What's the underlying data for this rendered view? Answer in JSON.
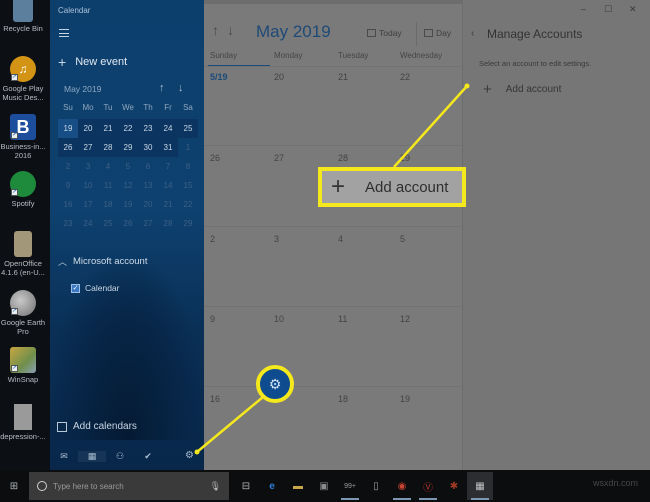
{
  "desktop": {
    "icons": [
      {
        "label": "Recycle Bin",
        "icon": "recycle-bin-icon",
        "color": "#6b8fb0"
      },
      {
        "label": "Google Play Music Des...",
        "icon": "music-icon",
        "color": "#d99a1e"
      },
      {
        "label": "Business-in... 2016",
        "icon": "document-b-icon",
        "color": "#1f4f9e"
      },
      {
        "label": "Spotify",
        "icon": "spotify-icon",
        "color": "#1f8a3e"
      },
      {
        "label": "OpenOffice 4.1.6 (en-U...",
        "icon": "openoffice-icon",
        "color": "#a89a78"
      },
      {
        "label": "Google Earth Pro",
        "icon": "globe-icon",
        "color": "#8a8a8a"
      },
      {
        "label": "WinSnap",
        "icon": "winsnap-icon",
        "color": "#7a8e4e"
      },
      {
        "label": "depression-...",
        "icon": "file-icon",
        "color": "#9a9a9a"
      }
    ]
  },
  "sidebar": {
    "app_title": "Calendar",
    "menu_icon": "hamburger-icon",
    "new_event_label": "New event",
    "mini_calendar": {
      "month_label": "May 2019",
      "weekday_headers": [
        "Su",
        "Mo",
        "Tu",
        "We",
        "Th",
        "Fr",
        "Sa"
      ],
      "weeks": [
        [
          "19",
          "20",
          "21",
          "22",
          "23",
          "24",
          "25"
        ],
        [
          "26",
          "27",
          "28",
          "29",
          "30",
          "31",
          "1"
        ],
        [
          "2",
          "3",
          "4",
          "5",
          "6",
          "7",
          "8"
        ],
        [
          "9",
          "10",
          "11",
          "12",
          "13",
          "14",
          "15"
        ],
        [
          "16",
          "17",
          "18",
          "19",
          "20",
          "21",
          "22"
        ],
        [
          "23",
          "24",
          "25",
          "26",
          "27",
          "28",
          "29"
        ]
      ],
      "today": "19"
    },
    "account_group": {
      "label": "Microsoft account",
      "expanded": true,
      "calendars": [
        {
          "label": "Calendar",
          "checked": true
        }
      ]
    },
    "add_calendars_label": "Add calendars",
    "bottom_icons": [
      "mail-icon",
      "calendar-icon",
      "people-icon",
      "todo-icon",
      "settings-icon"
    ]
  },
  "main": {
    "month_title": "May 2019",
    "today_label": "Today",
    "day_label": "Day",
    "weekdays": [
      "Sunday",
      "Monday",
      "Tuesday",
      "Wednesday"
    ],
    "weeks": [
      [
        "5/19",
        "20",
        "21",
        "22"
      ],
      [
        "26",
        "27",
        "28",
        "29"
      ],
      [
        "2",
        "3",
        "4",
        "5"
      ],
      [
        "9",
        "10",
        "11",
        "12"
      ],
      [
        "16",
        "17",
        "18",
        "19"
      ]
    ]
  },
  "pane": {
    "title": "Manage Accounts",
    "description": "Select an account to edit settings.",
    "add_account_label": "Add account",
    "window_controls": {
      "minimize": "–",
      "maximize": "☐",
      "close": "✕"
    }
  },
  "callouts": {
    "add_account_label": "Add account",
    "highlight_color": "#f5e81c"
  },
  "taskbar": {
    "search_placeholder": "Type here to search",
    "mail_badge": "99+",
    "watermark": "wsxdn.com"
  }
}
